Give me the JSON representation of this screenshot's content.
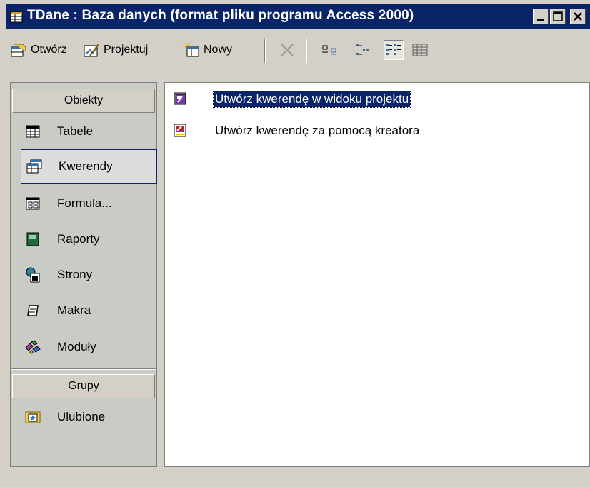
{
  "window": {
    "title": "TDane : Baza danych (format pliku programu Access 2000)",
    "app_icon": "database-window-icon",
    "controls": [
      "minimize-icon",
      "maximize-icon",
      "close-icon"
    ]
  },
  "toolbar": {
    "open_label": "Otwórz",
    "design_label": "Projektuj",
    "new_label": "Nowy",
    "icons": [
      "delete-icon",
      "large-icons-view-icon",
      "small-icons-view-icon",
      "list-view-icon",
      "details-view-icon"
    ]
  },
  "sidebar": {
    "objects_header": "Obiekty",
    "items": [
      {
        "label": "Tabele",
        "icon": "table-icon"
      },
      {
        "label": "Kwerendy",
        "icon": "query-icon"
      },
      {
        "label": "Formula...",
        "icon": "form-icon"
      },
      {
        "label": "Raporty",
        "icon": "report-icon"
      },
      {
        "label": "Strony",
        "icon": "page-icon"
      },
      {
        "label": "Makra",
        "icon": "macro-icon"
      },
      {
        "label": "Moduły",
        "icon": "module-icon"
      }
    ],
    "selected": "Kwerendy",
    "groups_header": "Grupy",
    "groups": [
      {
        "label": "Ulubione",
        "icon": "favorites-folder-icon"
      }
    ]
  },
  "main": {
    "items": [
      {
        "label": "Utwórz kwerendę w widoku projektu",
        "icon": "query-design-icon",
        "selected": true
      },
      {
        "label": "Utwórz kwerendę za pomocą kreatora",
        "icon": "query-wizard-icon",
        "selected": false
      }
    ]
  },
  "colors": {
    "title_bar": "#0a246a",
    "selection": "#0a246a",
    "face": "#d4d0c8",
    "sidebar_bg": "#c8ccc4"
  }
}
